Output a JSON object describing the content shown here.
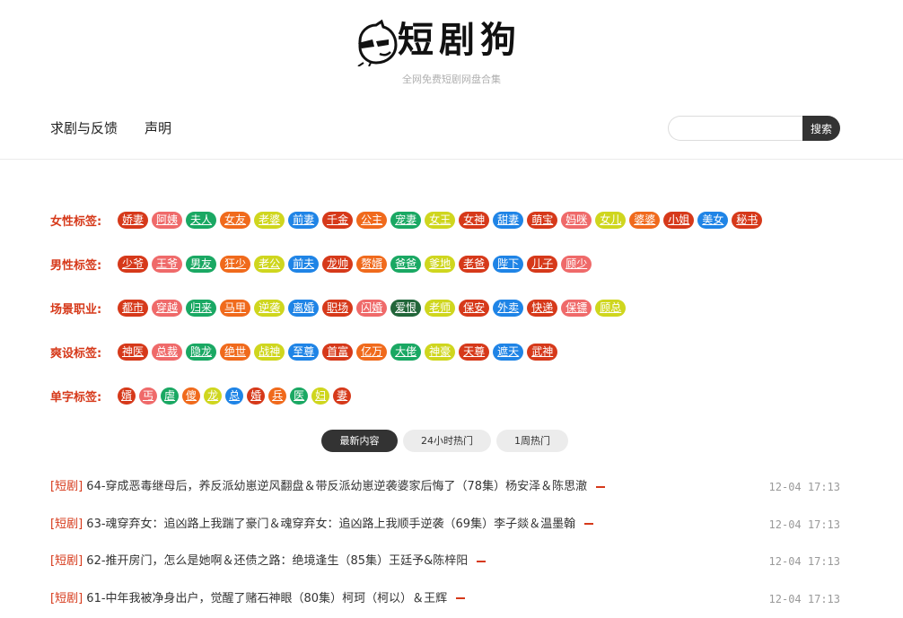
{
  "site": {
    "title": "短剧狗",
    "tagline": "全网免费短剧网盘合集"
  },
  "nav": [
    {
      "label": "求剧与反馈"
    },
    {
      "label": "声明"
    }
  ],
  "search": {
    "placeholder": "",
    "button_label": "搜索"
  },
  "colors": {
    "red": "#d6391a",
    "pink": "#ef6a6a",
    "green": "#1aa863",
    "orange": "#f06a1c",
    "yellow": "#cfd61e",
    "blue": "#1f84e6",
    "darkgreen": "#22663a"
  },
  "tag_groups": [
    {
      "label": "女性标签:",
      "tags": [
        {
          "text": "娇妻",
          "color": "red"
        },
        {
          "text": "阿姨",
          "color": "pink"
        },
        {
          "text": "夫人",
          "color": "green"
        },
        {
          "text": "女友",
          "color": "orange"
        },
        {
          "text": "老婆",
          "color": "yellow"
        },
        {
          "text": "前妻",
          "color": "blue"
        },
        {
          "text": "千金",
          "color": "red"
        },
        {
          "text": "公主",
          "color": "orange"
        },
        {
          "text": "宠妻",
          "color": "green"
        },
        {
          "text": "女王",
          "color": "yellow"
        },
        {
          "text": "女神",
          "color": "red"
        },
        {
          "text": "甜妻",
          "color": "blue"
        },
        {
          "text": "萌宝",
          "color": "red"
        },
        {
          "text": "妈咪",
          "color": "pink"
        },
        {
          "text": "女儿",
          "color": "yellow"
        },
        {
          "text": "婆婆",
          "color": "orange"
        },
        {
          "text": "小姐",
          "color": "red"
        },
        {
          "text": "美女",
          "color": "blue"
        },
        {
          "text": "秘书",
          "color": "red"
        }
      ]
    },
    {
      "label": "男性标签:",
      "tags": [
        {
          "text": "少爷",
          "color": "red"
        },
        {
          "text": "王爷",
          "color": "pink"
        },
        {
          "text": "男友",
          "color": "green"
        },
        {
          "text": "狂少",
          "color": "orange"
        },
        {
          "text": "老公",
          "color": "yellow"
        },
        {
          "text": "前夫",
          "color": "blue"
        },
        {
          "text": "龙帅",
          "color": "red"
        },
        {
          "text": "赘婿",
          "color": "orange"
        },
        {
          "text": "爸爸",
          "color": "green"
        },
        {
          "text": "爹地",
          "color": "yellow"
        },
        {
          "text": "老爸",
          "color": "red"
        },
        {
          "text": "陛下",
          "color": "blue"
        },
        {
          "text": "儿子",
          "color": "red"
        },
        {
          "text": "顾少",
          "color": "pink"
        }
      ]
    },
    {
      "label": "场景职业:",
      "tags": [
        {
          "text": "都市",
          "color": "red"
        },
        {
          "text": "穿越",
          "color": "pink"
        },
        {
          "text": "归来",
          "color": "green"
        },
        {
          "text": "马甲",
          "color": "orange"
        },
        {
          "text": "逆袭",
          "color": "yellow"
        },
        {
          "text": "离婚",
          "color": "blue"
        },
        {
          "text": "职场",
          "color": "red"
        },
        {
          "text": "闪婚",
          "color": "pink"
        },
        {
          "text": "爱恨",
          "color": "darkgreen"
        },
        {
          "text": "老师",
          "color": "yellow"
        },
        {
          "text": "保安",
          "color": "red"
        },
        {
          "text": "外卖",
          "color": "blue"
        },
        {
          "text": "快递",
          "color": "red"
        },
        {
          "text": "保镖",
          "color": "pink"
        },
        {
          "text": "顾总",
          "color": "yellow"
        }
      ]
    },
    {
      "label": "爽设标签:",
      "tags": [
        {
          "text": "神医",
          "color": "red"
        },
        {
          "text": "总裁",
          "color": "pink"
        },
        {
          "text": "隐龙",
          "color": "green"
        },
        {
          "text": "绝世",
          "color": "orange"
        },
        {
          "text": "战神",
          "color": "yellow"
        },
        {
          "text": "至尊",
          "color": "blue"
        },
        {
          "text": "首富",
          "color": "red"
        },
        {
          "text": "亿万",
          "color": "orange"
        },
        {
          "text": "大佬",
          "color": "green"
        },
        {
          "text": "神豪",
          "color": "yellow"
        },
        {
          "text": "天尊",
          "color": "red"
        },
        {
          "text": "遮天",
          "color": "blue"
        },
        {
          "text": "武神",
          "color": "red"
        }
      ]
    },
    {
      "label": "单字标签:",
      "tags": [
        {
          "text": "婿",
          "color": "red"
        },
        {
          "text": "丐",
          "color": "pink"
        },
        {
          "text": "虐",
          "color": "green"
        },
        {
          "text": "傻",
          "color": "orange"
        },
        {
          "text": "龙",
          "color": "yellow"
        },
        {
          "text": "总",
          "color": "blue"
        },
        {
          "text": "婚",
          "color": "red"
        },
        {
          "text": "兵",
          "color": "orange"
        },
        {
          "text": "医",
          "color": "green"
        },
        {
          "text": "妇",
          "color": "yellow"
        },
        {
          "text": "妻",
          "color": "red"
        }
      ]
    }
  ],
  "tabs": [
    {
      "label": "最新内容",
      "active": true
    },
    {
      "label": "24小时热门",
      "active": false
    },
    {
      "label": "1周热门",
      "active": false
    }
  ],
  "list": [
    {
      "category": "[短剧]",
      "title": "64-穿成恶毒继母后，养反派幼崽逆风翻盘＆带反派幼崽逆袭婆家后悔了（78集）杨安泽＆陈思澈",
      "time": "12-04 17:13"
    },
    {
      "category": "[短剧]",
      "title": "63-魂穿弃女：追凶路上我踹了豪门＆魂穿弃女：追凶路上我顺手逆袭（69集）李子燚＆温墨翰",
      "time": "12-04 17:13"
    },
    {
      "category": "[短剧]",
      "title": "62-推开房门，怎么是她啊＆还债之路：绝境逢生（85集）王廷予&陈梓阳",
      "time": "12-04 17:13"
    },
    {
      "category": "[短剧]",
      "title": "61-中年我被净身出户，觉醒了赌石神眼（80集）柯珂（柯以）＆王辉",
      "time": "12-04 17:13"
    }
  ]
}
